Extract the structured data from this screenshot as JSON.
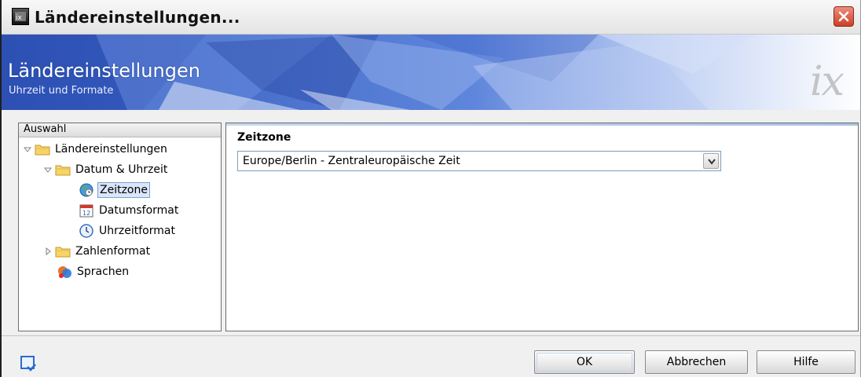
{
  "window": {
    "title": "Ländereinstellungen..."
  },
  "banner": {
    "title": "Ländereinstellungen",
    "subtitle": "Uhrzeit und Formate",
    "logo_text": "ix"
  },
  "tree": {
    "header": "Auswahl",
    "nodes": [
      {
        "label": "Ländereinstellungen",
        "icon": "folder-icon",
        "expander": "expanded"
      },
      {
        "label": "Datum & Uhrzeit",
        "icon": "folder-icon",
        "expander": "expanded"
      },
      {
        "label": "Zeitzone",
        "icon": "globe-clock-icon",
        "selected": true
      },
      {
        "label": "Datumsformat",
        "icon": "calendar-icon"
      },
      {
        "label": "Uhrzeitformat",
        "icon": "clock-icon"
      },
      {
        "label": "Zahlenformat",
        "icon": "folder-icon",
        "expander": "collapsed"
      },
      {
        "label": "Sprachen",
        "icon": "languages-icon"
      }
    ]
  },
  "content": {
    "heading": "Zeitzone",
    "timezone_selected": "Europe/Berlin - Zentraleuropäische Zeit"
  },
  "footer": {
    "ok_label": "OK",
    "cancel_label": "Abbrechen",
    "help_label": "Hilfe"
  },
  "colors": {
    "banner_blue": "#3f63c4",
    "selection_bg": "#dbe6f8",
    "close_red": "#cc3f25"
  }
}
